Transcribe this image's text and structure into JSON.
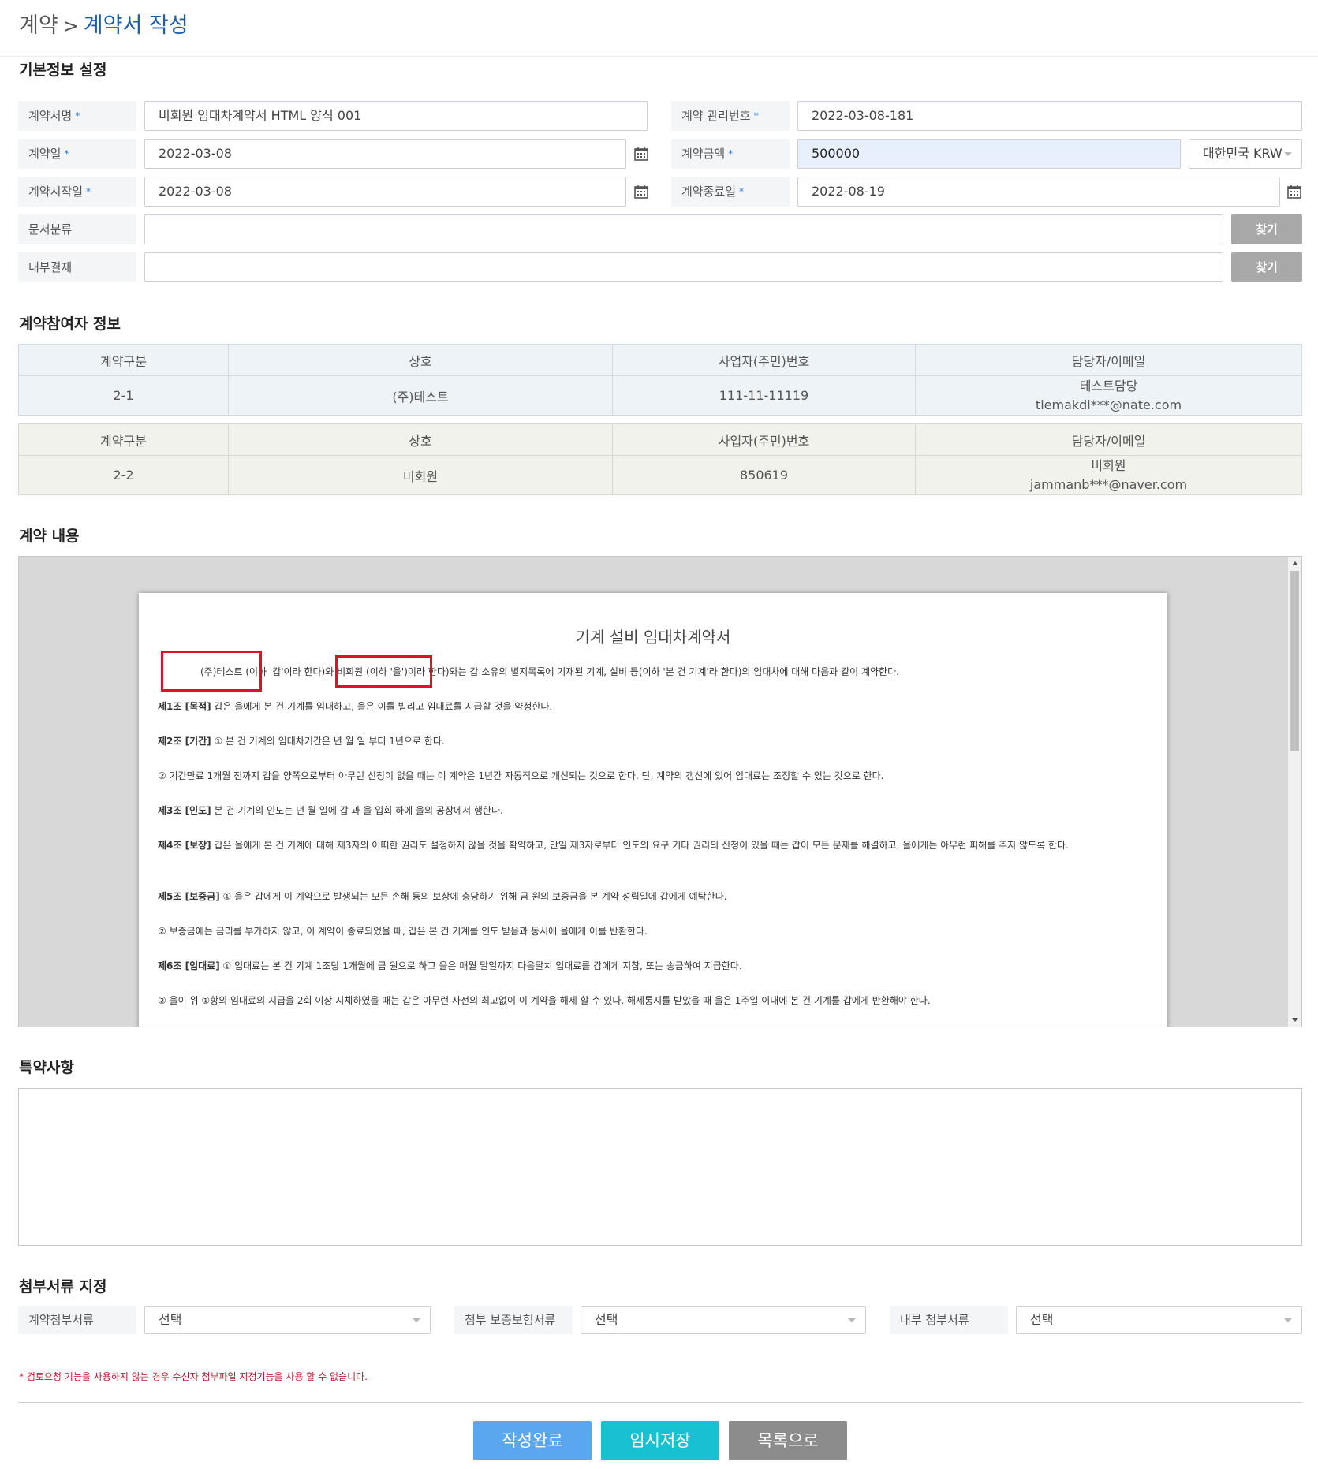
{
  "breadcrumb": {
    "parent": "계약",
    "separator": ">",
    "current": "계약서 작성"
  },
  "basic": {
    "section_title": "기본정보 설정",
    "required_mark": "*",
    "contract_name": {
      "label": "계약서명",
      "value": "비회원 임대차계약서 HTML 양식 001"
    },
    "management_no": {
      "label": "계약 관리번호",
      "value": "2022-03-08-181"
    },
    "contract_date": {
      "label": "계약일",
      "value": "2022-03-08"
    },
    "amount": {
      "label": "계약금액",
      "value": "500000",
      "currency": "대한민국 KRW"
    },
    "start_date": {
      "label": "계약시작일",
      "value": "2022-03-08"
    },
    "end_date": {
      "label": "계약종료일",
      "value": "2022-08-19"
    },
    "doc_category": {
      "label": "문서분류",
      "value": "",
      "button": "찾기"
    },
    "internal_approval": {
      "label": "내부결재",
      "value": "",
      "button": "찾기"
    }
  },
  "participants": {
    "section_title": "계약참여자 정보",
    "headers": [
      "계약구분",
      "상호",
      "사업자(주민)번호",
      "담당자/이메일"
    ],
    "rows": [
      {
        "type": "2-1",
        "company": "(주)테스트",
        "reg_no": "111-11-11119",
        "contact": "테스트담당",
        "email": "tlemakdl***@nate.com"
      },
      {
        "type": "2-2",
        "company": "비회원",
        "reg_no": "850619",
        "contact": "비회원",
        "email": "jammanb***@naver.com"
      }
    ]
  },
  "content": {
    "section_title": "계약 내용",
    "doc_title": "기계 설비 임대차계약서",
    "intro": {
      "party_a": "(주)테스트",
      "a_suffix": " (이하 '갑'이라 한다)와 ",
      "party_b": "비회원",
      "b_suffix": " (이하 '을')이라 한다)와는 갑 소유의 별지목록에 기재된 기계, 설비 등(이하 '본 건 기계'라 한다)의 임대차에 대해 다음과 같이 계약한다."
    },
    "clauses": [
      {
        "head": "제1조 [목적]",
        "text": " 갑은 을에게 본 건 기계를 임대하고, 을은 이를 빌리고 임대료를 지급할 것을 약정한다."
      },
      {
        "head": "제2조 [기간]",
        "text": " ① 본 건 기계의 임대차기간은    년    월     일 부터 1년으로 한다."
      },
      {
        "head": "",
        "text": "② 기간만료 1개월 전까지 갑을 양쪽으로부터 아무런 신청이 없을 때는 이 계약은 1년간 자동적으로 개신되는 것으로 한다. 단, 계약의 갱신에 있어 임대료는 조정할 수 있는 것으로 한다."
      },
      {
        "head": "제3조 [인도]",
        "text": " 본 건 기계의 인도는     년    월    일에 갑 과 을 입회 하에 을의 공장에서 행한다."
      },
      {
        "head": "제4조 [보장]",
        "text": " 갑은 을에게 본 건 기계에 대해 제3자의 어떠한 권리도 설정하지 않을 것을 확약하고, 만일 제3자로부터 인도의 요구 기타 권리의 신청이 있을 때는 갑이 모든 문제를 해결하고, 을에게는 아무런 피해를 주지 않도록 한다."
      },
      {
        "head": "제5조 [보증금]",
        "text": " ① 을은 갑에게 이 계약으로 발생되는 모든 손해 등의 보상에 충당하기 위해 금 원의 보증금을 본 계약 성립일에 갑에게 예탁한다."
      },
      {
        "head": "",
        "text": "② 보증금에는 금리를 부가하지 않고, 이 계약이 종료되었을 때, 갑은 본 건 기계를 인도 받음과 동시에 을에게 이를 반환한다."
      },
      {
        "head": "제6조 [임대료]",
        "text": " ① 임대료는 본 건 기계 1조당 1개월에 금        원으로 하고 을은 매월 말일까지 다음달치 임대료를 갑에게 지참, 또는 송금하여 지급한다."
      },
      {
        "head": "",
        "text": "② 을이 위 ①항의 임대료의 지급을 2회 이상 지체하였을 때는 갑은 아무런 사전의 최고없이 이 계약을 해제 할 수 있다. 해제통지를 받았을 때 을은 1주일 이내에 본 건 기계를 갑에게 반환해야 한다."
      }
    ]
  },
  "special": {
    "section_title": "특약사항",
    "value": ""
  },
  "attachments": {
    "section_title": "첨부서류 지정",
    "items": [
      {
        "label": "계약첨부서류",
        "value": "선택"
      },
      {
        "label": "첨부 보증보험서류",
        "value": "선택"
      },
      {
        "label": "내부 첨부서류",
        "value": "선택"
      }
    ],
    "note": "* 검토요청 기능을 사용하지 않는 경우 수신자 첨부파일 지정기능을 사용 할 수 없습니다."
  },
  "actions": {
    "complete": "작성완료",
    "temp_save": "임시저장",
    "to_list": "목록으로"
  },
  "colors": {
    "accent": "#1e5ba8",
    "complete_btn": "#5aa6ef",
    "temp_btn": "#18c1d2",
    "list_btn": "#8c8c8c",
    "highlight_box": "#e0102a"
  }
}
